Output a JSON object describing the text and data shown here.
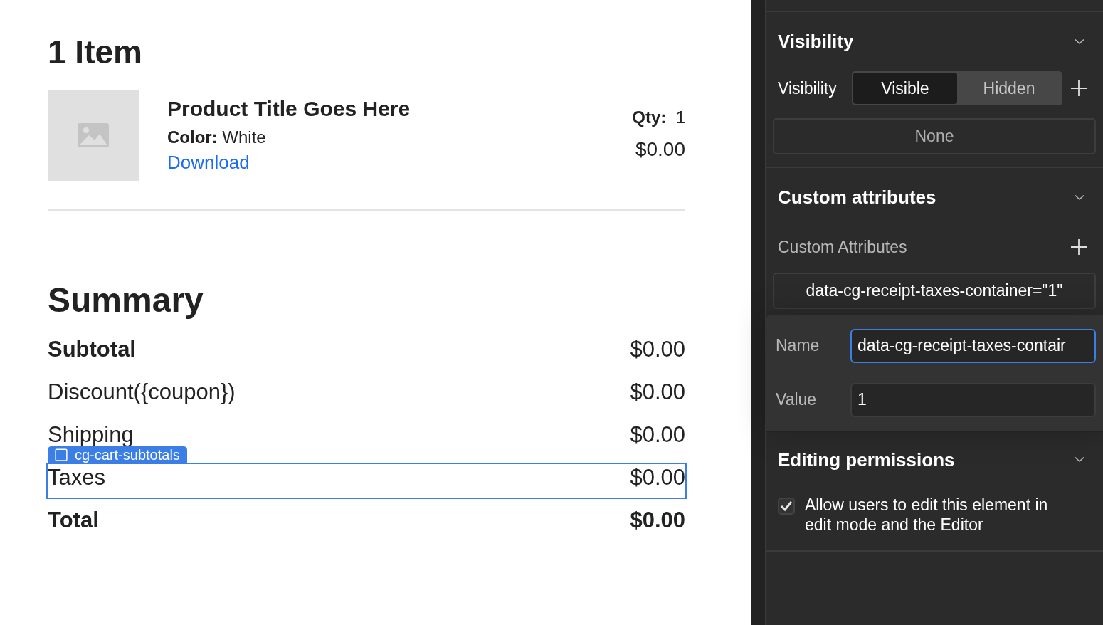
{
  "canvas": {
    "heading": "1 Item",
    "product": {
      "title": "Product Title Goes Here",
      "color_label": "Color:",
      "color_value": "White",
      "link": "Download",
      "qty_label": "Qty:",
      "qty_value": "1",
      "price": "$0.00"
    },
    "summary_heading": "Summary",
    "rows": [
      {
        "kind": "subtotal",
        "label": "Subtotal",
        "value": "$0.00",
        "selected": false
      },
      {
        "kind": "plain",
        "label": "Discount({coupon})",
        "value": "$0.00",
        "selected": false
      },
      {
        "kind": "plain",
        "label": "Shipping",
        "value": "$0.00",
        "selected": false
      },
      {
        "kind": "plain",
        "label": "Taxes",
        "value": "$0.00",
        "selected": true
      },
      {
        "kind": "total",
        "label": "Total",
        "value": "$0.00",
        "selected": false
      }
    ],
    "selection_badge": "cg-cart-subtotals"
  },
  "panel": {
    "visibility": {
      "heading": "Visibility",
      "label": "Visibility",
      "options": [
        {
          "label": "Visible",
          "selected": true
        },
        {
          "label": "Hidden",
          "selected": false
        }
      ],
      "condition_button": "None"
    },
    "custom_attributes": {
      "heading": "Custom attributes",
      "label": "Custom Attributes",
      "attribute": "data-cg-receipt-taxes-container=\"1\"",
      "editor": {
        "name_label": "Name",
        "name_value": "data-cg-receipt-taxes-contair",
        "name_focused": true,
        "value_label": "Value",
        "value_value": "1",
        "value_focused": false
      }
    },
    "editing_permissions": {
      "heading": "Editing permissions",
      "checkbox_label": "Allow users to edit this element in edit mode and the Editor",
      "checked": true
    }
  }
}
